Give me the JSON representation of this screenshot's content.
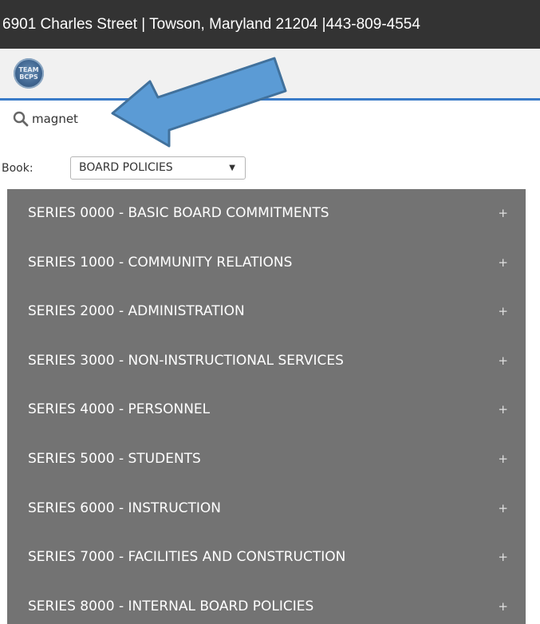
{
  "header": {
    "address": "6901 Charles Street | Towson, Maryland 21204 |443-809-4554"
  },
  "logo": {
    "line1": "TEAM",
    "line2": "BCPS"
  },
  "search": {
    "value": "magnet",
    "icon": "search-icon"
  },
  "book": {
    "label": "Book:",
    "selected": "BOARD POLICIES"
  },
  "series": [
    {
      "label": "SERIES 0000 - BASIC BOARD COMMITMENTS",
      "expand": "+"
    },
    {
      "label": "SERIES 1000 - COMMUNITY RELATIONS",
      "expand": "+"
    },
    {
      "label": "SERIES 2000 - ADMINISTRATION",
      "expand": "+"
    },
    {
      "label": "SERIES 3000 - NON-INSTRUCTIONAL SERVICES",
      "expand": "+"
    },
    {
      "label": "SERIES 4000 - PERSONNEL",
      "expand": "+"
    },
    {
      "label": "SERIES 5000 - STUDENTS",
      "expand": "+"
    },
    {
      "label": "SERIES 6000 - INSTRUCTION",
      "expand": "+"
    },
    {
      "label": "SERIES 7000 - FACILITIES AND CONSTRUCTION",
      "expand": "+"
    },
    {
      "label": "SERIES 8000 - INTERNAL BOARD POLICIES",
      "expand": "+"
    }
  ],
  "colors": {
    "header_bg": "#333333",
    "menu_bg": "#737373",
    "accent": "#3a7bc8",
    "arrow": "#5b9bd5"
  }
}
